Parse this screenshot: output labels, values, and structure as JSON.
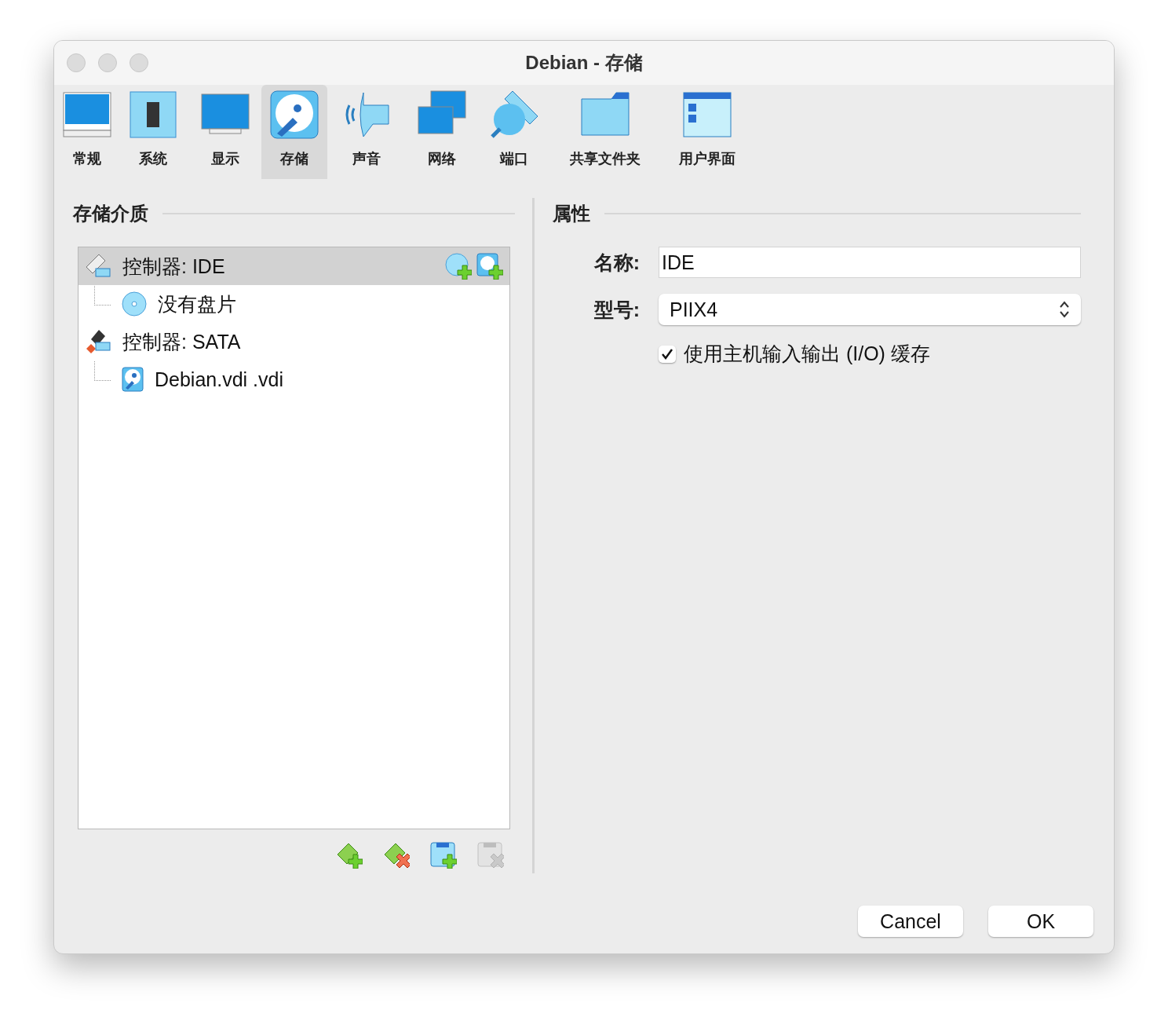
{
  "window": {
    "title": "Debian - 存储"
  },
  "tabs": [
    {
      "label": "常规",
      "kind": "general",
      "selected": false
    },
    {
      "label": "系统",
      "kind": "system",
      "selected": false
    },
    {
      "label": "显示",
      "kind": "display",
      "selected": false
    },
    {
      "label": "存储",
      "kind": "storage",
      "selected": true
    },
    {
      "label": "声音",
      "kind": "audio",
      "selected": false
    },
    {
      "label": "网络",
      "kind": "network",
      "selected": false
    },
    {
      "label": "端口",
      "kind": "ports",
      "selected": false
    },
    {
      "label": "共享文件夹",
      "kind": "shared",
      "selected": false
    },
    {
      "label": "用户界面",
      "kind": "ui",
      "selected": false
    }
  ],
  "storage": {
    "title": "存储介质",
    "tree": [
      {
        "label": "控制器: IDE",
        "kind": "ide-controller",
        "selected": true,
        "children": [
          {
            "label": "没有盘片",
            "kind": "optical-disc",
            "selected": false
          }
        ]
      },
      {
        "label": "控制器: SATA",
        "kind": "sata-controller",
        "selected": false,
        "children": [
          {
            "label": "Debian.vdi .vdi",
            "kind": "hard-disk",
            "selected": false
          }
        ]
      }
    ],
    "actions": [
      {
        "kind": "add-controller",
        "disabled": false
      },
      {
        "kind": "remove-controller",
        "disabled": false
      },
      {
        "kind": "add-attachment",
        "disabled": false
      },
      {
        "kind": "remove-attachment",
        "disabled": true
      }
    ]
  },
  "attributes": {
    "title": "属性",
    "name_label": "名称:",
    "name_value": "IDE",
    "type_label": "型号:",
    "type_value": "PIIX4",
    "cache": {
      "label": "使用主机输入输出 (I/O) 缓存",
      "checked": true
    }
  },
  "buttons": [
    {
      "label": "Cancel"
    },
    {
      "label": "OK"
    }
  ]
}
